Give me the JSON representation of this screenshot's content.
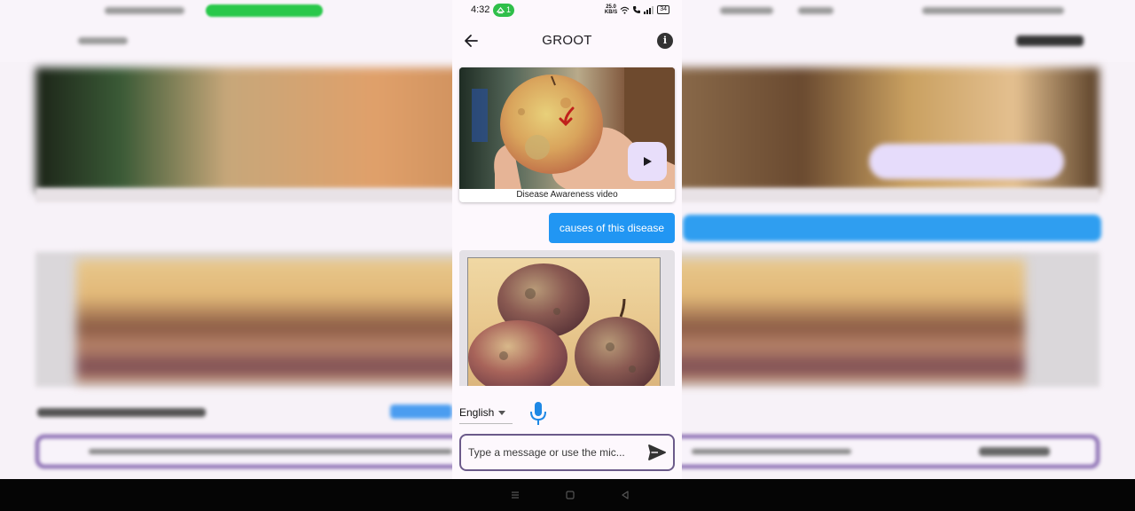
{
  "status_bar": {
    "time": "4:32",
    "notification_count": "1",
    "network_speed_value": "25.0",
    "network_speed_unit": "KB/S",
    "battery": "34"
  },
  "app_bar": {
    "title": "GROOT",
    "back_icon": "arrow-left-icon",
    "info_icon": "info-icon"
  },
  "chat": {
    "messages": [
      {
        "type": "video",
        "caption": "Disease Awareness video",
        "play_icon": "play-icon"
      },
      {
        "type": "user_text",
        "text": "causes of this disease"
      },
      {
        "type": "image"
      }
    ]
  },
  "controls": {
    "language": {
      "selected": "English"
    },
    "mic_icon": "microphone-icon"
  },
  "composer": {
    "placeholder": "Type a message or use the mic...",
    "value": "",
    "send_icon": "send-icon"
  },
  "nav_bar": {
    "icons": [
      "menu-icon",
      "home-square-icon",
      "back-triangle-icon"
    ]
  },
  "colors": {
    "user_bubble": "#2196f3",
    "play_button_bg": "#e8defa",
    "input_border": "#6b5a8a",
    "mic": "#1e88e5",
    "status_pill": "#2fbf4a"
  }
}
